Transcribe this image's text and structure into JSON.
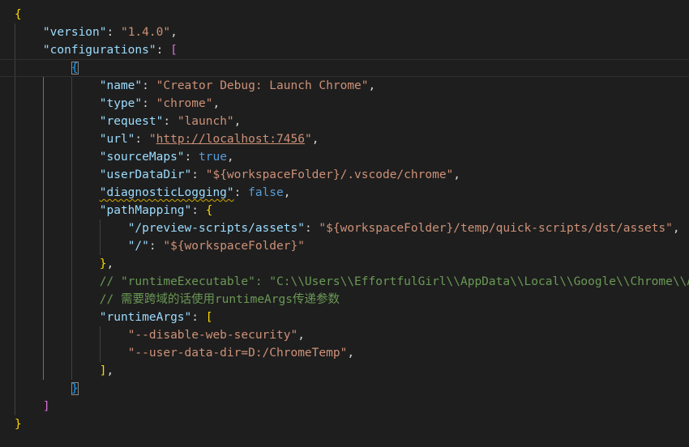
{
  "lines": [
    {
      "tokens": [
        {
          "t": "{",
          "c": "b1"
        }
      ]
    },
    {
      "tokens": [
        {
          "t": "\"version\"",
          "c": "key"
        },
        {
          "t": ": ",
          "c": "punc"
        },
        {
          "t": "\"1.4.0\"",
          "c": "str"
        },
        {
          "t": ",",
          "c": "punc"
        }
      ]
    },
    {
      "tokens": [
        {
          "t": "\"configurations\"",
          "c": "key"
        },
        {
          "t": ": ",
          "c": "punc"
        },
        {
          "t": "[",
          "c": "b2"
        }
      ]
    },
    {
      "tokens": [
        {
          "t": "{",
          "c": "b3",
          "m": true
        }
      ]
    },
    {
      "tokens": [
        {
          "t": "\"name\"",
          "c": "key"
        },
        {
          "t": ": ",
          "c": "punc"
        },
        {
          "t": "\"Creator Debug: Launch Chrome\"",
          "c": "str"
        },
        {
          "t": ",",
          "c": "punc"
        }
      ]
    },
    {
      "tokens": [
        {
          "t": "\"type\"",
          "c": "key"
        },
        {
          "t": ": ",
          "c": "punc"
        },
        {
          "t": "\"chrome\"",
          "c": "str"
        },
        {
          "t": ",",
          "c": "punc"
        }
      ]
    },
    {
      "tokens": [
        {
          "t": "\"request\"",
          "c": "key"
        },
        {
          "t": ": ",
          "c": "punc"
        },
        {
          "t": "\"launch\"",
          "c": "str"
        },
        {
          "t": ",",
          "c": "punc"
        }
      ]
    },
    {
      "tokens": [
        {
          "t": "\"url\"",
          "c": "key"
        },
        {
          "t": ": ",
          "c": "punc"
        },
        {
          "t": "\"",
          "c": "str"
        },
        {
          "t": "http://localhost:7456",
          "c": "str link"
        },
        {
          "t": "\"",
          "c": "str"
        },
        {
          "t": ",",
          "c": "punc"
        }
      ]
    },
    {
      "tokens": [
        {
          "t": "\"sourceMaps\"",
          "c": "key"
        },
        {
          "t": ": ",
          "c": "punc"
        },
        {
          "t": "true",
          "c": "kw"
        },
        {
          "t": ",",
          "c": "punc"
        }
      ]
    },
    {
      "tokens": [
        {
          "t": "\"userDataDir\"",
          "c": "key"
        },
        {
          "t": ": ",
          "c": "punc"
        },
        {
          "t": "\"${workspaceFolder}/.vscode/chrome\"",
          "c": "str"
        },
        {
          "t": ",",
          "c": "punc"
        }
      ]
    },
    {
      "tokens": [
        {
          "t": "\"diagnosticLogging\"",
          "c": "key squig"
        },
        {
          "t": ": ",
          "c": "punc"
        },
        {
          "t": "false",
          "c": "kw"
        },
        {
          "t": ",",
          "c": "punc"
        }
      ]
    },
    {
      "tokens": [
        {
          "t": "\"pathMapping\"",
          "c": "key"
        },
        {
          "t": ": ",
          "c": "punc"
        },
        {
          "t": "{",
          "c": "b1"
        }
      ]
    },
    {
      "tokens": [
        {
          "t": "\"/preview-scripts/assets\"",
          "c": "key"
        },
        {
          "t": ": ",
          "c": "punc"
        },
        {
          "t": "\"${workspaceFolder}/temp/quick-scripts/dst/assets\"",
          "c": "str"
        },
        {
          "t": ",",
          "c": "punc"
        }
      ]
    },
    {
      "tokens": [
        {
          "t": "\"/\"",
          "c": "key"
        },
        {
          "t": ": ",
          "c": "punc"
        },
        {
          "t": "\"${workspaceFolder}\"",
          "c": "str"
        }
      ]
    },
    {
      "tokens": [
        {
          "t": "}",
          "c": "b1"
        },
        {
          "t": ",",
          "c": "punc"
        }
      ]
    },
    {
      "tokens": [
        {
          "t": "// \"runtimeExecutable\": \"C:\\\\Users\\\\EffortfulGirl\\\\AppData\\\\Local\\\\Google\\\\Chrome\\\\Application\\\\chrome.exe\",",
          "c": "cmt"
        }
      ]
    },
    {
      "tokens": [
        {
          "t": "// 需要跨域的话使用runtimeArgs传递参数",
          "c": "cmt"
        }
      ]
    },
    {
      "tokens": [
        {
          "t": "\"runtimeArgs\"",
          "c": "key"
        },
        {
          "t": ": ",
          "c": "punc"
        },
        {
          "t": "[",
          "c": "b1"
        }
      ]
    },
    {
      "tokens": [
        {
          "t": "\"--disable-web-security\"",
          "c": "str"
        },
        {
          "t": ",",
          "c": "punc"
        }
      ]
    },
    {
      "tokens": [
        {
          "t": "\"--user-data-dir=D:/ChromeTemp\"",
          "c": "str"
        },
        {
          "t": ",",
          "c": "punc"
        }
      ]
    },
    {
      "tokens": [
        {
          "t": "]",
          "c": "b1"
        },
        {
          "t": ",",
          "c": "punc"
        }
      ]
    },
    {
      "tokens": [
        {
          "t": "}",
          "c": "b3",
          "m": true
        }
      ]
    },
    {
      "tokens": [
        {
          "t": "]",
          "c": "b2"
        }
      ]
    },
    {
      "tokens": [
        {
          "t": "}",
          "c": "b1"
        }
      ]
    }
  ]
}
